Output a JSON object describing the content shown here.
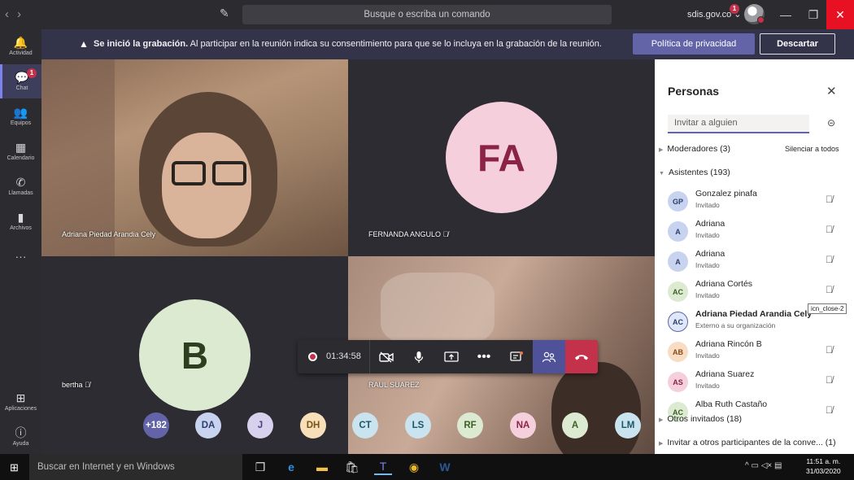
{
  "titlebar": {
    "command_placeholder": "Busque o escriba un comando",
    "tenant": "sdis.gov.co",
    "tenant_badge": "1",
    "back_glyph": "‹",
    "forward_glyph": "›",
    "compose_icon": "compose-icon",
    "minimize_glyph": "—",
    "maximize_glyph": "❐",
    "close_glyph": "✕"
  },
  "appbar": {
    "items": [
      {
        "label": "Actividad",
        "icon": "🔔",
        "badge": ""
      },
      {
        "label": "Chat",
        "icon": "💬",
        "badge": "1"
      },
      {
        "label": "Equipos",
        "icon": "👥",
        "badge": ""
      },
      {
        "label": "Calendario",
        "icon": "▦",
        "badge": ""
      },
      {
        "label": "Llamadas",
        "icon": "✆",
        "badge": ""
      },
      {
        "label": "Archivos",
        "icon": "▮",
        "badge": ""
      }
    ],
    "more_glyph": "···",
    "apps_label": "Aplicaciones",
    "help_label": "Ayuda"
  },
  "banner": {
    "warning_glyph": "▲",
    "bold": "Se inició la grabación.",
    "text": " Al participar en la reunión indica su consentimiento para que se lo incluya en la grabación de la reunión.",
    "policy_button": "Política de privacidad",
    "dismiss_button": "Descartar"
  },
  "tiles": {
    "t1_label": "Adriana Piedad Arandia Cely",
    "t2_label": "FERNANDA ANGULO",
    "t2_initials": "FA",
    "t3_label": "bertha",
    "t3_initials": "B",
    "t4_label": "RAUL SUAREZ",
    "mic_off_glyph": "🎙̸"
  },
  "controls": {
    "timer": "01:34:58"
  },
  "strip": [
    {
      "initials": "+182",
      "bg": "#6264a7",
      "fg": "#ffffff"
    },
    {
      "initials": "DA",
      "bg": "#c8d3f0",
      "fg": "#2e3c6b"
    },
    {
      "initials": "J",
      "bg": "#d7d1ee",
      "fg": "#4b3f7c"
    },
    {
      "initials": "DH",
      "bg": "#f6dfb9",
      "fg": "#7a5412"
    },
    {
      "initials": "CT",
      "bg": "#c9e4ee",
      "fg": "#1e5567"
    },
    {
      "initials": "LS",
      "bg": "#c9e4ee",
      "fg": "#1e5567"
    },
    {
      "initials": "RF",
      "bg": "#dbead0",
      "fg": "#3e5e27"
    },
    {
      "initials": "NA",
      "bg": "#f5d0dc",
      "fg": "#8a2346"
    },
    {
      "initials": "A",
      "bg": "#dbead0",
      "fg": "#3e5e27"
    },
    {
      "initials": "LM",
      "bg": "#c9e4ee",
      "fg": "#1e5567"
    }
  ],
  "panel": {
    "title": "Personas",
    "invite_placeholder": "Invitar a alguien",
    "moderators": "Moderadores (3)",
    "mute_all": "Silenciar a todos",
    "attendees": "Asistentes (193)",
    "others": "Otros invitados (18)",
    "invite_others": "Invitar a otros participantes de la conve... (1)",
    "tooltip": "icn_close-2",
    "people": [
      {
        "initials": "GP",
        "name": "Gonzalez pinafa",
        "sub": "Invitado",
        "bg": "#c8d3f0",
        "fg": "#2e3c6b",
        "bold": false,
        "mic": true
      },
      {
        "initials": "A",
        "name": "Adriana",
        "sub": "Invitado",
        "bg": "#c8d3f0",
        "fg": "#2e3c6b",
        "bold": false,
        "mic": true
      },
      {
        "initials": "A",
        "name": "Adriana",
        "sub": "Invitado",
        "bg": "#c8d3f0",
        "fg": "#2e3c6b",
        "bold": false,
        "mic": true
      },
      {
        "initials": "AC",
        "name": "Adriana Cortés",
        "sub": "Invitado",
        "bg": "#dbead0",
        "fg": "#3e5e27",
        "bold": false,
        "mic": true
      },
      {
        "initials": "AC",
        "name": "Adriana Piedad Arandia Cely",
        "sub": "Externo a su organización",
        "bg": "#dfe7fa",
        "fg": "#2e3c6b",
        "bold": true,
        "mic": false
      },
      {
        "initials": "AB",
        "name": "Adriana Rincón B",
        "sub": "Invitado",
        "bg": "#f9dcc4",
        "fg": "#8a4b12",
        "bold": false,
        "mic": true
      },
      {
        "initials": "AS",
        "name": "Adriana Suarez",
        "sub": "Invitado",
        "bg": "#f5d0dc",
        "fg": "#8a2346",
        "bold": false,
        "mic": true
      },
      {
        "initials": "AC",
        "name": "Alba Ruth Castaño",
        "sub": "",
        "bg": "#dbead0",
        "fg": "#3e5e27",
        "bold": false,
        "mic": true
      }
    ]
  },
  "taskbar": {
    "search_placeholder": "Buscar en Internet y en Windows",
    "time": "11:51 a. m.",
    "date": "31/03/2020"
  }
}
